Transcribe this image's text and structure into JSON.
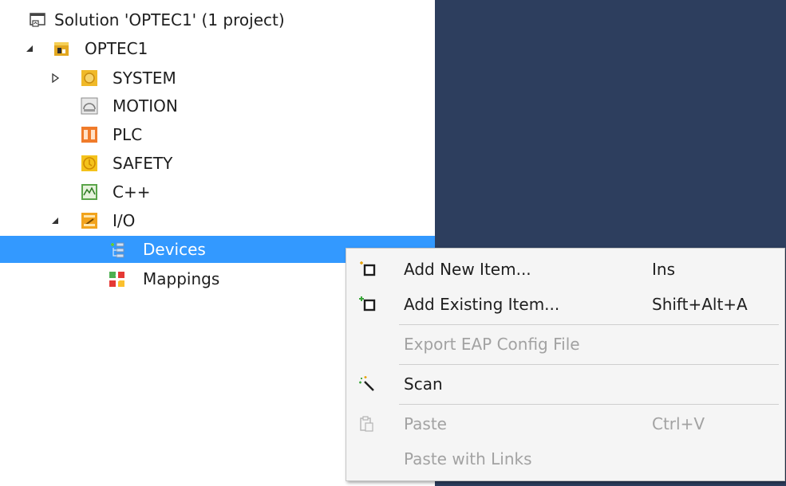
{
  "tree": {
    "solution_label": "Solution 'OPTEC1' (1 project)",
    "project_label": "OPTEC1",
    "items": [
      {
        "label": "SYSTEM",
        "icon": "system-icon"
      },
      {
        "label": "MOTION",
        "icon": "motion-icon"
      },
      {
        "label": "PLC",
        "icon": "plc-icon"
      },
      {
        "label": "SAFETY",
        "icon": "safety-icon"
      },
      {
        "label": "C++",
        "icon": "cpp-icon"
      },
      {
        "label": "I/O",
        "icon": "io-icon"
      }
    ],
    "io_children": [
      {
        "label": "Devices",
        "icon": "devices-icon",
        "selected": true
      },
      {
        "label": "Mappings",
        "icon": "mappings-icon",
        "selected": false
      }
    ]
  },
  "context_menu": {
    "items": [
      {
        "label": "Add New Item...",
        "shortcut": "Ins",
        "enabled": true,
        "icon": "add-new-item-icon"
      },
      {
        "label": "Add Existing Item...",
        "shortcut": "Shift+Alt+A",
        "enabled": true,
        "icon": "add-existing-item-icon"
      },
      {
        "label": "Export EAP Config File",
        "shortcut": "",
        "enabled": false
      },
      {
        "label": "Scan",
        "shortcut": "",
        "enabled": true,
        "icon": "scan-wand-icon"
      },
      {
        "label": "Paste",
        "shortcut": "Ctrl+V",
        "enabled": false,
        "icon": "paste-icon"
      },
      {
        "label": "Paste with Links",
        "shortcut": "",
        "enabled": false
      }
    ]
  },
  "colors": {
    "selection": "#3399ff",
    "dark_panel": "#2d3e5e",
    "menu_bg": "#f5f5f5",
    "disabled_text": "#a2a2a2"
  }
}
